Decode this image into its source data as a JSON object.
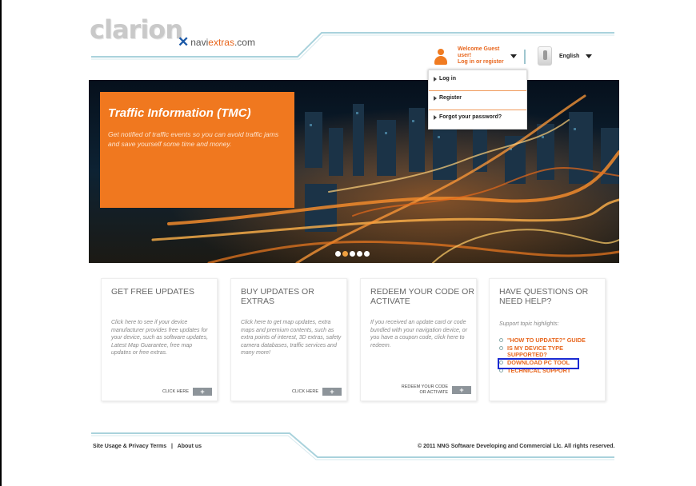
{
  "header": {
    "logo": "clarion",
    "naviextras": {
      "prefix": "navi",
      "middle": "extras",
      "suffix": ".com"
    },
    "user": {
      "welcome": "Welcome Guest user!",
      "login_register": "Log in or register"
    },
    "language": "English"
  },
  "dropdown": {
    "items": [
      {
        "label": "Log in"
      },
      {
        "label": "Register"
      },
      {
        "label": "Forgot your password?"
      }
    ]
  },
  "hero": {
    "title": "Traffic Information (TMC)",
    "text": "Get notified of traffic events so you can avoid traffic jams and save yourself some time and money.",
    "slide_count": 5,
    "active_slide": 2
  },
  "cards": [
    {
      "title": "GET FREE UPDATES",
      "text": "Click here to see if your device manufacturer provides free updates for your device, such as software updates, Latest Map Guarantee, free map updates or free extras.",
      "action": "CLICK HERE"
    },
    {
      "title": "BUY UPDATES OR EXTRAS",
      "text": "Click here to get map updates, extra maps and premium contents, such as extra points of interest, 3D extras, safety camera databases, traffic services and many more!",
      "action": "CLICK HERE"
    },
    {
      "title": "REDEEM YOUR CODE OR ACTIVATE",
      "text": "If you received an update card or code bundled with your navigation device, or you have a coupon code, click here to redeem.",
      "action": "REDEEM YOUR CODE OR ACTIVATE"
    },
    {
      "title": "HAVE QUESTIONS OR NEED HELP?",
      "subtitle": "Support topic highlights:",
      "links": [
        "\"HOW TO UPDATE?\" GUIDE",
        "IS MY DEVICE TYPE SUPPORTED?",
        "DOWNLOAD PC TOOL",
        "TECHNICAL SUPPORT"
      ]
    }
  ],
  "footer": {
    "privacy": "Site Usage & Privacy Terms",
    "separator": "|",
    "about": "About us",
    "copyright": "© 2011 NNG Software Developing and Commercial Llc. All rights reserved."
  },
  "colors": {
    "accent": "#f0781f",
    "link": "#e8661d",
    "highlight": "#1a2ad2"
  }
}
